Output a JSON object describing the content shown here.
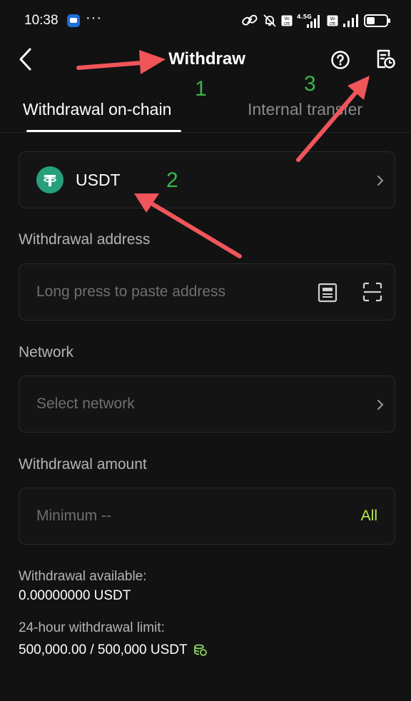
{
  "status_bar": {
    "time": "10:38",
    "more": "···",
    "network_label": "4.5G",
    "sim_label": "Vo LTE"
  },
  "header": {
    "title": "Withdraw"
  },
  "tabs": [
    {
      "label": "Withdrawal on-chain",
      "active": true
    },
    {
      "label": "Internal transfer",
      "active": false
    }
  ],
  "coin": {
    "name": "USDT",
    "icon": "tether-icon",
    "icon_color": "#26a17b"
  },
  "address": {
    "label": "Withdrawal address",
    "placeholder": "Long press to paste address"
  },
  "network": {
    "label": "Network",
    "placeholder": "Select network"
  },
  "amount": {
    "label": "Withdrawal amount",
    "placeholder": "Minimum --",
    "all_label": "All"
  },
  "info": {
    "available_label": "Withdrawal available:",
    "available_value": "0.00000000  USDT",
    "limit_label": "24-hour withdrawal limit:",
    "limit_value": "500,000.00 / 500,000 USDT"
  },
  "annotations": [
    "1",
    "2",
    "3"
  ],
  "colors": {
    "background": "#121212",
    "accent": "#b5e850",
    "annotation_arrow": "#f0555a",
    "annotation_number": "#39b54a"
  }
}
